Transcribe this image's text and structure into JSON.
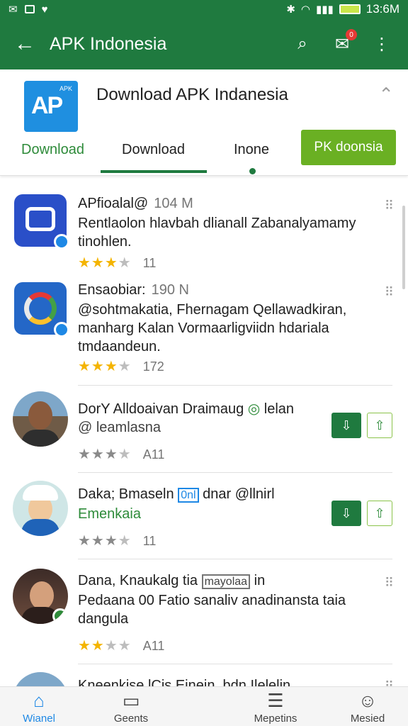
{
  "status_bar": {
    "time": "13:6M"
  },
  "app_bar": {
    "title": "APK Indonesia",
    "badge": "0"
  },
  "header": {
    "logo_apk": "APK",
    "logo_text": "AP",
    "title": "Download APK Indanesia",
    "tabs": [
      "Download",
      "Download",
      "Inone"
    ],
    "install_label": "PK doonsia"
  },
  "items": [
    {
      "title": "APfioalal@",
      "meta": "104 M",
      "desc": "Rentlaolon hlavbah dlianall Zabanalyamamy tinohlen.",
      "rating": 3,
      "count": "11"
    },
    {
      "title": "Ensaobiar:",
      "meta": "190 N",
      "desc": "@sohtmakatia, Fhernagam Qellawadkiran, manharg Kalan Vormaarligviidn hdariala tmdaandeun.",
      "rating": 3,
      "count": "172"
    },
    {
      "title": "DorY Alldoaivan Draimaug",
      "title_tail": "lelan",
      "sub": "@ leamlasna",
      "rating": 3,
      "count": "A11"
    },
    {
      "title": "Daka; Bmaseln",
      "tag": "0nl",
      "title_tail": "dnar @llnirl",
      "sub": "Emenkaia",
      "rating": 3,
      "count": "11"
    },
    {
      "title": "Dana, Knaukalg tia",
      "tag": "mayolaa",
      "title_tail": "in",
      "desc": "Pedaana 00 Fatio sanaliv anadinansta taia dangula",
      "rating": 2,
      "count": "A11"
    },
    {
      "title": "Kneenkise lCis Einein. bdn Ilelelin"
    }
  ],
  "bottom_nav": [
    {
      "label": "Wianel",
      "icon": "home-icon"
    },
    {
      "label": "Geents",
      "icon": "chat-icon"
    },
    {
      "label": "Mepetins",
      "icon": "list-icon"
    },
    {
      "label": "Mesied",
      "icon": "profile-icon"
    }
  ]
}
